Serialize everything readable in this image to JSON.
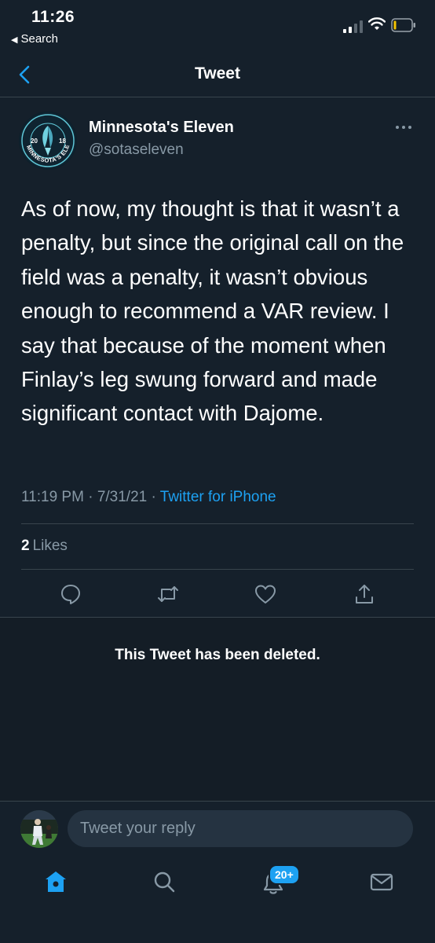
{
  "status": {
    "time": "11:26",
    "back_app": "Search"
  },
  "header": {
    "title": "Tweet"
  },
  "tweet": {
    "author_name": "Minnesota's Eleven",
    "author_handle": "@sotaseleven",
    "text": "As of now, my thought is that it wasn’t a penalty, but since the original call on the field was a penalty, it wasn’t obvious enough to recommend a VAR review. I say that because of the moment when Finlay’s leg swung forward and made significant contact with Dajome.",
    "time": "11:19 PM",
    "date": "7/31/21",
    "source": "Twitter for iPhone",
    "likes_count": "2",
    "likes_label": "Likes"
  },
  "avatar_logo": {
    "top_left": "20",
    "top_right": "18",
    "ring_text": "MINNESOTA'S ELEVEN"
  },
  "deleted": {
    "message": "This Tweet has been deleted."
  },
  "reply": {
    "placeholder": "Tweet your reply"
  },
  "tabbar": {
    "notifications_badge": "20+"
  },
  "colors": {
    "background": "#15202b",
    "accent": "#1da1f2",
    "secondary_text": "#8899a6",
    "divider": "#38444d"
  },
  "icons": [
    "chevron-left-icon",
    "more-icon",
    "reply-icon",
    "retweet-icon",
    "like-icon",
    "share-icon",
    "home-icon",
    "search-icon",
    "notifications-icon",
    "messages-icon"
  ]
}
